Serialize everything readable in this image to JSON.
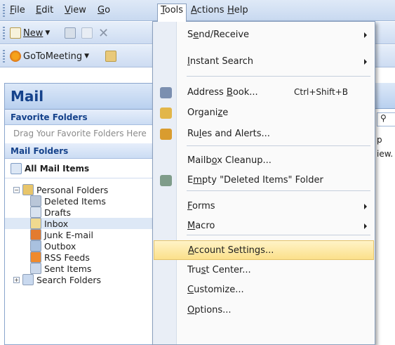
{
  "menubar": {
    "items": [
      {
        "label": "File",
        "ul": 0
      },
      {
        "label": "Edit",
        "ul": 0
      },
      {
        "label": "View",
        "ul": 0
      },
      {
        "label": "Go",
        "ul": 0
      },
      {
        "label": "Tools",
        "ul": 0,
        "active": true
      },
      {
        "label": "Actions",
        "ul": 0
      },
      {
        "label": "Help",
        "ul": 0
      }
    ]
  },
  "toolbar": {
    "new_label": "New",
    "gotomeeting_label": "GoToMeeting"
  },
  "navigation": {
    "title": "Mail",
    "favorite_folders_header": "Favorite Folders",
    "favorite_folders_hint": "Drag Your Favorite Folders Here",
    "mail_folders_header": "Mail Folders",
    "all_mail_items": "All Mail Items",
    "folders": [
      {
        "label": "Personal Folders",
        "level": 0,
        "expander": "−",
        "icon": "personal-folders-icon"
      },
      {
        "label": "Deleted Items",
        "level": 1,
        "icon": "deleted-items-icon"
      },
      {
        "label": "Drafts",
        "level": 1,
        "icon": "drafts-icon"
      },
      {
        "label": "Inbox",
        "level": 1,
        "icon": "inbox-icon",
        "selected": true
      },
      {
        "label": "Junk E-mail",
        "level": 1,
        "icon": "junk-email-icon"
      },
      {
        "label": "Outbox",
        "level": 1,
        "icon": "outbox-icon"
      },
      {
        "label": "RSS Feeds",
        "level": 1,
        "icon": "rss-feeds-icon"
      },
      {
        "label": "Sent Items",
        "level": 1,
        "icon": "sent-items-icon"
      },
      {
        "label": "Search Folders",
        "level": 0,
        "expander": "+",
        "icon": "search-folders-icon"
      }
    ]
  },
  "right_pane": {
    "fragment_1": "p",
    "fragment_2": "iew."
  },
  "tools_menu": {
    "items": [
      {
        "label": "Send/Receive",
        "ul": 1,
        "submenu": true
      },
      {
        "label": "Instant Search",
        "ul": 0,
        "submenu": true
      },
      {
        "label": "Address Book...",
        "ul": 8,
        "shortcut": "Ctrl+Shift+B",
        "icon": "address-book-icon"
      },
      {
        "label": "Organize",
        "ul": 6,
        "icon": "organize-icon"
      },
      {
        "label": "Rules and Alerts...",
        "ul": 2,
        "icon": "rules-alerts-icon"
      },
      {
        "label": "Mailbox Cleanup...",
        "ul": 5
      },
      {
        "label": "Empty \"Deleted Items\" Folder",
        "ul": 1,
        "icon": "empty-deleted-icon"
      },
      {
        "label": "Forms",
        "ul": 0,
        "submenu": true
      },
      {
        "label": "Macro",
        "ul": 0,
        "submenu": true
      },
      {
        "label": "Account Settings...",
        "ul": 0,
        "highlighted": true
      },
      {
        "label": "Trust Center...",
        "ul": 3
      },
      {
        "label": "Customize...",
        "ul": 0
      },
      {
        "label": "Options...",
        "ul": 0
      }
    ]
  },
  "colors": {
    "accent": "#15428b",
    "highlight": "#fbe08a",
    "menubar": "#c8d9f0"
  }
}
